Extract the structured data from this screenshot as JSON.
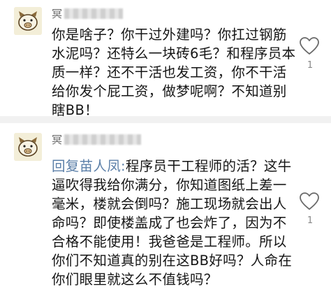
{
  "comments": [
    {
      "username": "冥",
      "avatar_icon": "cartoon-pig-avatar",
      "text": "你是啥子？你干过外建吗？你扛过钢筋水泥吗？还特么一块砖6毛？和程序员本质一样？还不干活也发工资，你不干活给你发个屁工资，做梦呢啊？不知道别瞎BB！",
      "like_count": "1",
      "like_icon": "heart-outline-icon"
    },
    {
      "username": "冥",
      "avatar_icon": "cartoon-pig-avatar",
      "reply_prefix": "回复苗人凤:",
      "text": "程序员干工程师的活？这牛逼吹得我给你满分，你知道图纸上差一毫米，楼就会倒吗？施工现场就会出人命吗？即使楼盖成了也会炸了，因为不合格不能使用！我爸爸是工程师。所以你们不知道真的别在这BB好吗？人命在你们眼里就这么不值钱吗？",
      "like_count": "1",
      "like_icon": "heart-outline-icon"
    }
  ],
  "colors": {
    "text": "#151515",
    "username": "#666666",
    "reply_prefix": "#5b7fa8",
    "like_count": "#888888",
    "divider": "#f1f1f1"
  }
}
